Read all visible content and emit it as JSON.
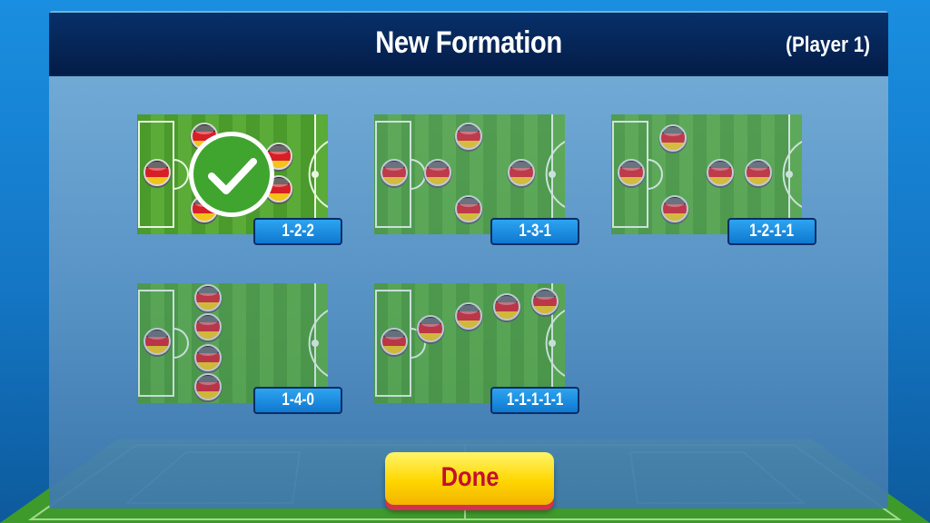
{
  "header": {
    "title": "New Formation",
    "player": "(Player 1)"
  },
  "formations": [
    {
      "label": "1-2-2",
      "selected": true
    },
    {
      "label": "1-3-1",
      "selected": false
    },
    {
      "label": "1-2-1-1",
      "selected": false
    },
    {
      "label": "1-4-0",
      "selected": false
    },
    {
      "label": "1-1-1-1-1",
      "selected": false
    }
  ],
  "done_label": "Done",
  "colors": {
    "header_bg": "#041c47",
    "label_bg": "#1a8fe0",
    "done_bg": "#ffd600",
    "done_text": "#c3102f",
    "pitch_green": "#3f9b2e"
  },
  "icons": {
    "player_token": "germany-flag-token-icon",
    "selected_mark": "check-circle-icon"
  }
}
